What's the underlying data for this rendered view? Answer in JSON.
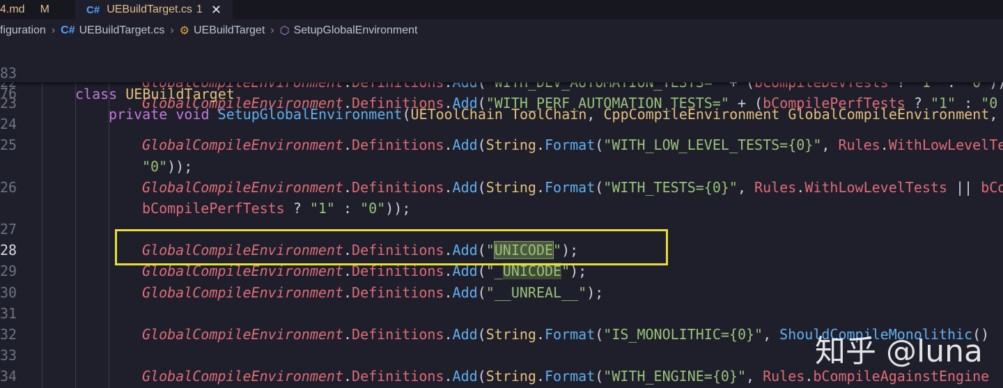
{
  "tabs": [
    {
      "label": "4.md",
      "modified": "M"
    },
    {
      "label": "UEBuildTarget.cs",
      "problems": "1",
      "close": "✕"
    }
  ],
  "breadcrumb": [
    "figuration",
    "UEBuildTarget.cs",
    "UEBuildTarget",
    "SetupGlobalEnvironment"
  ],
  "sticky": [
    {
      "ln": "83",
      "text": "class UEBuildTarget"
    },
    {
      "ln": "76",
      "text": "private void SetupGlobalEnvironment(UEToolChain ToolChain, CppCompileEnvironment GlobalCompileEnvironment,"
    }
  ],
  "lines": [
    {
      "ln": "22",
      "text": "GlobalCompileEnvironment.Definitions.Add(\"WITH_DEV_AUTOMATION_TESTS=\" + (bCompileDevTests ? \"1\" : \"0\"));"
    },
    {
      "ln": "23",
      "text": "GlobalCompileEnvironment.Definitions.Add(\"WITH_PERF_AUTOMATION_TESTS=\" + (bCompilePerfTests ? \"1\" : \"0"
    },
    {
      "ln": "24",
      "text": ""
    },
    {
      "ln": "25",
      "text": "GlobalCompileEnvironment.Definitions.Add(String.Format(\"WITH_LOW_LEVEL_TESTS={0}\", Rules.WithLowLevelTe"
    },
    {
      "ln": "",
      "text": "\"0\"));"
    },
    {
      "ln": "26",
      "text": "GlobalCompileEnvironment.Definitions.Add(String.Format(\"WITH_TESTS={0}\", Rules.WithLowLevelTests || bCo"
    },
    {
      "ln": "",
      "text": "bCompilePerfTests ? \"1\" : \"0\"));"
    },
    {
      "ln": "27",
      "text": ""
    },
    {
      "ln": "28",
      "text": "GlobalCompileEnvironment.Definitions.Add(\"UNICODE\");"
    },
    {
      "ln": "29",
      "text": "GlobalCompileEnvironment.Definitions.Add(\"_UNICODE\");"
    },
    {
      "ln": "30",
      "text": "GlobalCompileEnvironment.Definitions.Add(\"__UNREAL__\");"
    },
    {
      "ln": "31",
      "text": ""
    },
    {
      "ln": "32",
      "text": "GlobalCompileEnvironment.Definitions.Add(String.Format(\"IS_MONOLITHIC={0}\", ShouldCompileMonolithic()"
    },
    {
      "ln": "33",
      "text": ""
    },
    {
      "ln": "34",
      "text": "GlobalCompileEnvironment.Definitions.Add(String.Format(\"WITH_ENGINE={0}\", Rules.bCompileAgainstEngine"
    }
  ],
  "watermark": "知乎 @luna",
  "colors": {
    "keyword": "#c678dd",
    "type": "#e5c07b",
    "function": "#61afef",
    "variable": "#e06c75",
    "string": "#98c379",
    "highlight_box": "#e8e033"
  }
}
